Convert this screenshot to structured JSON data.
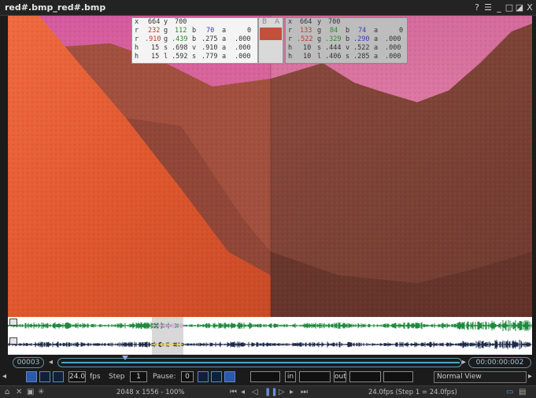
{
  "window": {
    "title": "red#.bmp_red#.bmp",
    "controls": {
      "help": "?",
      "menu": "☰",
      "minimize": "_",
      "restore": "□",
      "maximize": "◪",
      "close": "X"
    }
  },
  "pixel_info_a": {
    "rows": [
      [
        "x",
        "664",
        "y",
        "700",
        "",
        ""
      ],
      [
        "r",
        "232",
        "g",
        "112",
        "b",
        "70",
        "a",
        "0"
      ],
      [
        "r",
        ".910",
        "g",
        ".439",
        "b",
        ".275",
        "a",
        ".000"
      ],
      [
        "h",
        "15",
        "s",
        ".698",
        "v",
        ".910",
        "a",
        ".000"
      ],
      [
        "h",
        "15",
        "l",
        ".592",
        "s",
        ".779",
        "a",
        ".000"
      ]
    ]
  },
  "pixel_info_b": {
    "rows": [
      [
        "x",
        "664",
        "y",
        "700",
        "",
        ""
      ],
      [
        "r",
        "133",
        "g",
        "84",
        "b",
        "74",
        "a",
        "0"
      ],
      [
        "r",
        ".522",
        "g",
        ".329",
        "b",
        ".290",
        "a",
        ".000"
      ],
      [
        "h",
        "10",
        "s",
        ".444",
        "v",
        ".522",
        "a",
        ".000"
      ],
      [
        "h",
        "10",
        "l",
        ".406",
        "s",
        ".285",
        "a",
        ".000"
      ]
    ]
  },
  "swatch": {
    "label_b": "B",
    "label_a": "A",
    "color": "#c2503a"
  },
  "timeline": {
    "frame": "00003",
    "timecode": "00:00:00:002",
    "position_fraction": 0.16
  },
  "controls": {
    "fps_value": "24.0",
    "fps_label": "fps",
    "step_label": "Step",
    "step_value": "1",
    "pause_label": "Pause:",
    "pause_value": "0",
    "in_label": "in",
    "out_label": "out",
    "view_mode": "Normal View"
  },
  "status": {
    "resolution": "2048 x 1556 - 100%",
    "playback": "24.0fps (Step 1 = 24.0fps)"
  },
  "colors": {
    "accent": "#5a86c8",
    "wave_green": "#1f8a3e",
    "wave_navy": "#1d2a4a",
    "wave_highlight": "#e7a8e0"
  }
}
